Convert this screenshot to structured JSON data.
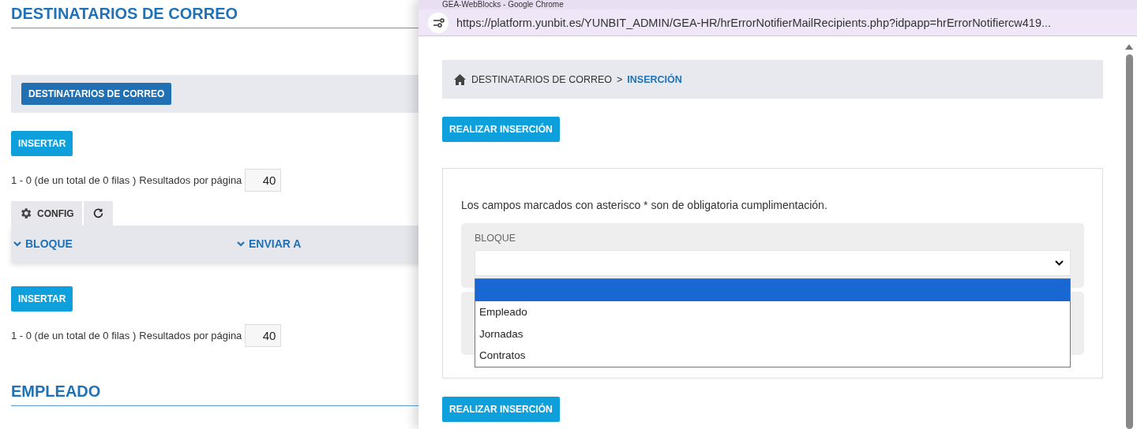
{
  "page": {
    "title": "DESTINATARIOS DE CORREO",
    "tab_button": "DESTINATARIOS DE CORREO",
    "insert_buttons": [
      "INSERTAR",
      "INSERTAR"
    ],
    "pagers": [
      {
        "summary": "1 - 0 (de un total de 0 filas )",
        "per_page_label": "Resultados por página",
        "per_page": "40"
      },
      {
        "summary": "1 - 0 (de un total de 0 filas )",
        "per_page_label": "Resultados por página",
        "per_page": "40"
      }
    ],
    "toolbar": {
      "config": "CONFIG"
    },
    "columns": [
      "BLOQUE",
      "ENVIAR A"
    ],
    "next_section": "EMPLEADO"
  },
  "popup": {
    "window_title": "GEA-WebBlocks - Google Chrome",
    "url": "https://platform.yunbit.es/YUNBIT_ADMIN/GEA-HR/hrErrorNotifierMailRecipients.php?idpapp=hrErrorNotifiercw419...",
    "breadcrumb": [
      {
        "label": "DESTINATARIOS DE CORREO",
        "current": false
      },
      {
        "label": "INSERCIÓN",
        "current": true
      }
    ],
    "breadcrumb_separator": ">",
    "action_buttons": [
      "REALIZAR INSERCIÓN",
      "REALIZAR INSERCIÓN"
    ],
    "note": "Los campos marcados con asterisco * son de obligatoria cumplimentación.",
    "field": {
      "label": "BLOQUE",
      "expanded": true,
      "options": [
        {
          "selected": true
        },
        {
          "label": "Empleado",
          "selected": false
        },
        {
          "label": "Jornadas",
          "selected": false
        },
        {
          "label": "Contratos",
          "selected": false
        }
      ]
    }
  }
}
